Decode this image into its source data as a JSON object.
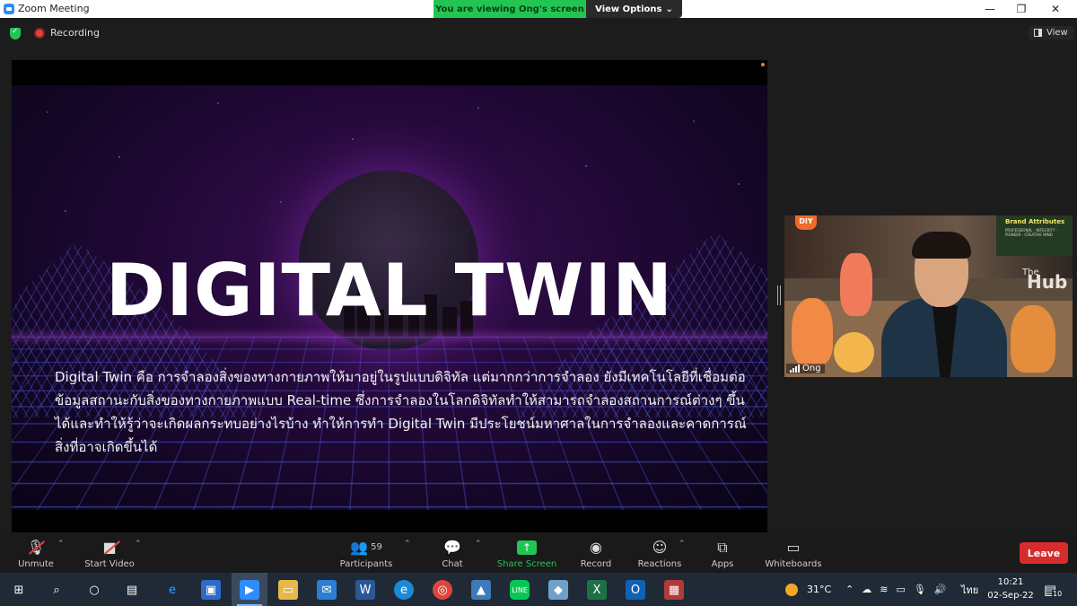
{
  "window": {
    "title": "Zoom Meeting",
    "share_banner": "You are viewing Ong's screen",
    "view_options": "View Options",
    "minimize": "—",
    "maximize": "❐",
    "close": "✕"
  },
  "meeting": {
    "recording_label": "Recording",
    "view_label": "View"
  },
  "slide": {
    "title": "DIGITAL TWIN",
    "body": "Digital Twin คือ การจำลองสิ่งของทางกายภาพให้มาอยู่ในรูปแบบดิจิทัล แต่มากกว่าการจำลอง ยังมีเทคโนโลยีที่เชื่อมต่อข้อมูลสถานะกับสิ่งของทางกายภาพแบบ Real-time ซึ่งการจำลองในโลกดิจิทัลทำให้สามารถจำลองสถานการณ์ต่างๆ ขึ้นได้และทำให้รู้ว่าจะเกิดผลกระทบอย่างไรบ้าง ทำให้การทำ Digital Twin มีประโยชน์มหาศาลในการจำลองและคาดการณ์สิ่งที่อาจเกิดขึ้นได้"
  },
  "participant": {
    "name": "Ong",
    "background_text_the": "The",
    "background_text_hub": "Hub",
    "board_title": "Brand Attributes",
    "board_sub": "PROFESSIONAL · INTEGRITY · PIONEER · CREATIVE MIND",
    "logo": "DIY"
  },
  "toolbar": {
    "unmute": "Unmute",
    "start_video": "Start Video",
    "participants": "Participants",
    "participants_count": "59",
    "chat": "Chat",
    "share_screen": "Share Screen",
    "record": "Record",
    "reactions": "Reactions",
    "apps": "Apps",
    "whiteboards": "Whiteboards",
    "leave": "Leave"
  },
  "taskbar": {
    "temperature": "31°C",
    "language": "ไทย",
    "time": "10:21",
    "date": "02-Sep-22",
    "notifications": "10"
  },
  "colors": {
    "zoom_blue": "#2d8cff",
    "share_green": "#23c552",
    "leave_red": "#d62c2c"
  }
}
